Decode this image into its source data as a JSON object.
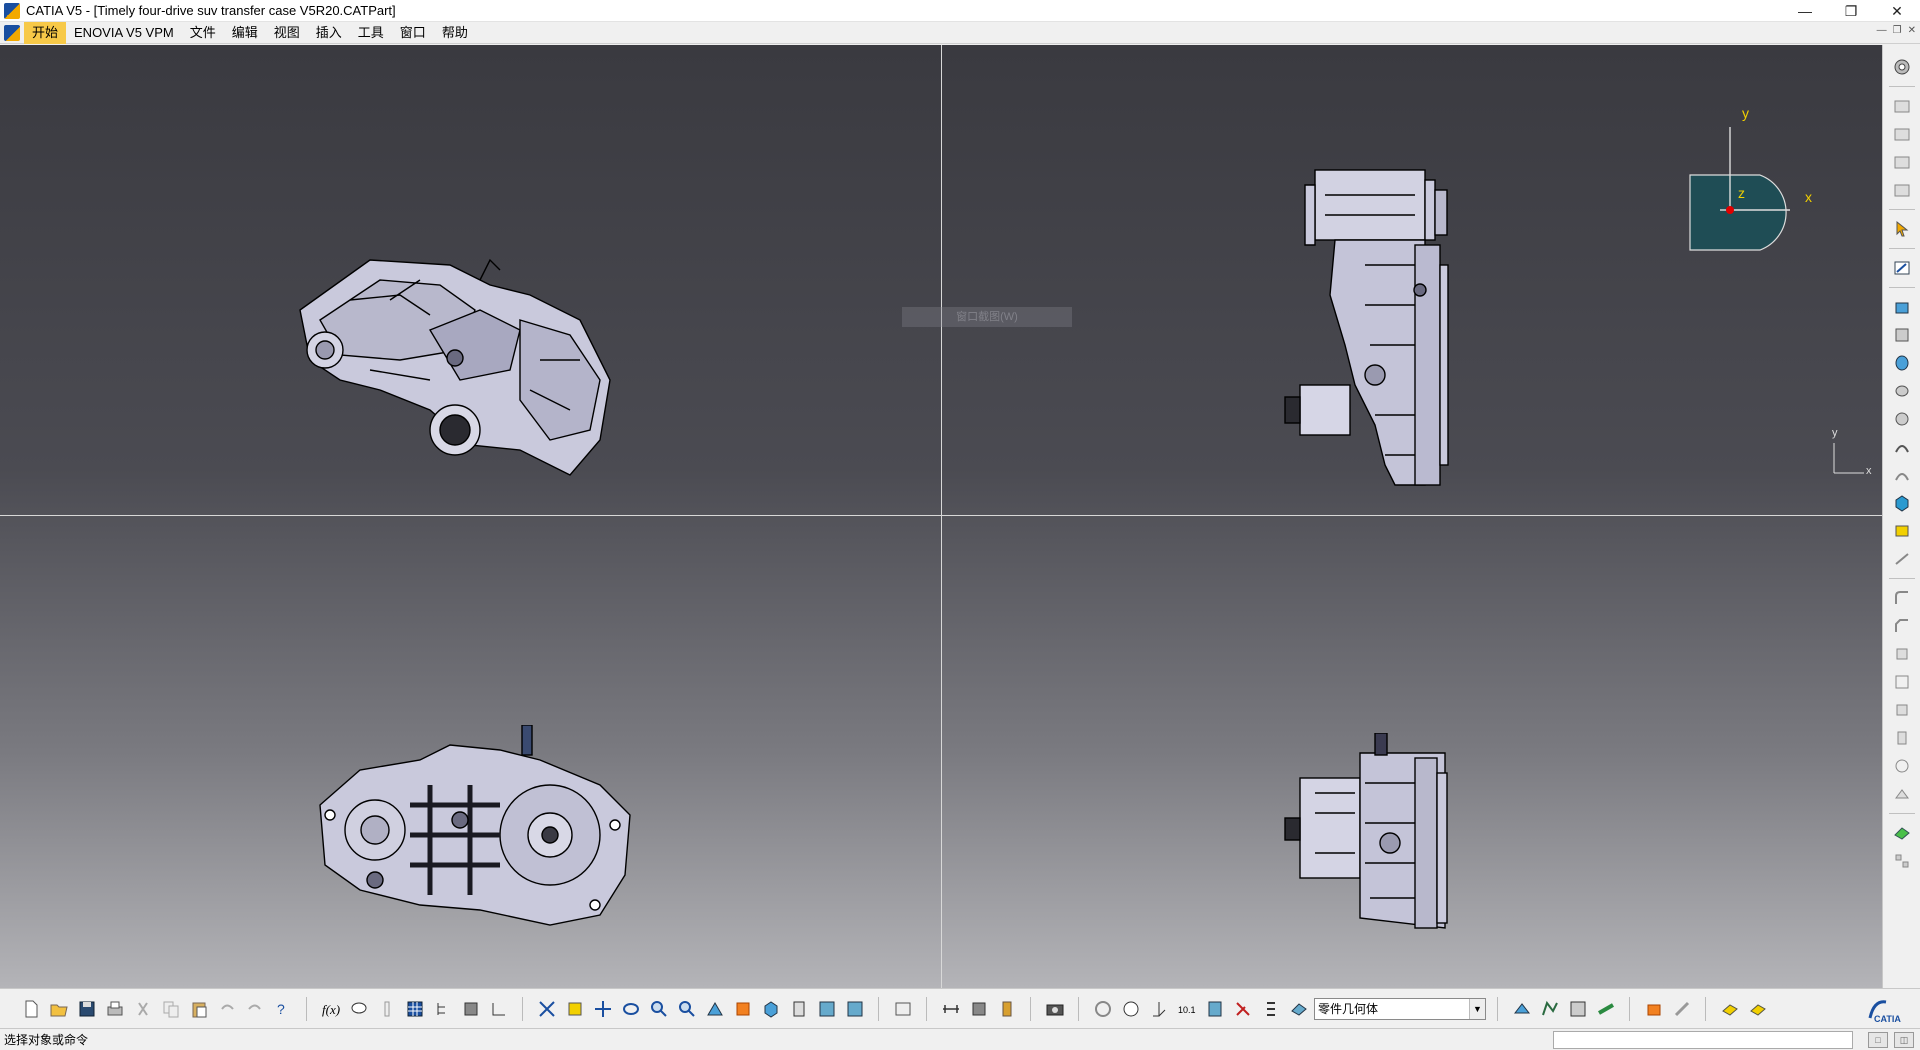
{
  "window": {
    "title": "CATIA V5 - [Timely four-drive suv transfer case V5R20.CATPart]",
    "minimize": "—",
    "restore": "❐",
    "close": "✕"
  },
  "menu": {
    "items": [
      "开始",
      "ENOVIA V5 VPM",
      "文件",
      "编辑",
      "视图",
      "插入",
      "工具",
      "窗口",
      "帮助"
    ]
  },
  "viewport": {
    "ghost_tooltip": "窗口截图(W)",
    "compass_labels": {
      "x": "x",
      "y": "y",
      "z": "z"
    },
    "mini_axis_labels": {
      "x": "x",
      "y": "y"
    },
    "colors": {
      "part": "#c9c9dc",
      "edge": "#000000",
      "compass_fill": "#1f4d55",
      "axis_label": "#f2d000"
    }
  },
  "toolbar": {
    "combo_value": "零件几何体"
  },
  "status": {
    "message": "选择对象或命令",
    "btn1": "□",
    "btn2": "◫"
  },
  "icons": {
    "bottom": [
      "new-icon",
      "open-icon",
      "save-icon",
      "print-icon",
      "cut-icon",
      "copy-icon",
      "paste-icon",
      "undo-icon",
      "redo-icon",
      "whats-this-icon",
      "formula-icon",
      "knowledge-icon",
      "thermometer-icon",
      "grid-icon",
      "tree-icon",
      "sketch-analysis-icon",
      "3d-compass-icon",
      "fit-all-icon",
      "pan-icon",
      "rotate-icon",
      "zoom-in-icon",
      "zoom-out-icon",
      "normal-view-icon",
      "shading-icon",
      "multi-view-icon",
      "iso-view-icon",
      "render-style-icon",
      "hide-show-icon",
      "swap-visible-icon",
      "measure-between-icon",
      "measure-item-icon",
      "mass-icon",
      "capture-icon",
      "update-icon",
      "parameter-icon",
      "axis-system-icon",
      "dimension-icon",
      "constraint-icon",
      "draft-icon",
      "list-icon",
      "part-body-icon",
      "catalog-icon",
      "material-icon",
      "apply-material-icon",
      "texture-icon",
      "pen-icon",
      "ruler-icon",
      "layers-icon",
      "filter-icon"
    ],
    "right": [
      "gear-icon",
      "feature-1-icon",
      "feature-2-icon",
      "feature-3-icon",
      "feature-4-icon",
      "select-icon",
      "sketcher-icon",
      "pad-icon",
      "pocket-icon",
      "shaft-icon",
      "groove-icon",
      "hole-icon",
      "rib-icon",
      "slot-icon",
      "solid-icon",
      "stiffener-icon",
      "loft-icon",
      "fillet-icon",
      "chamfer-icon",
      "draft-angle-icon",
      "shell-icon",
      "thickness-icon",
      "thread-icon",
      "split-icon",
      "boolean-icon",
      "measure-icon",
      "pattern-icon"
    ]
  }
}
